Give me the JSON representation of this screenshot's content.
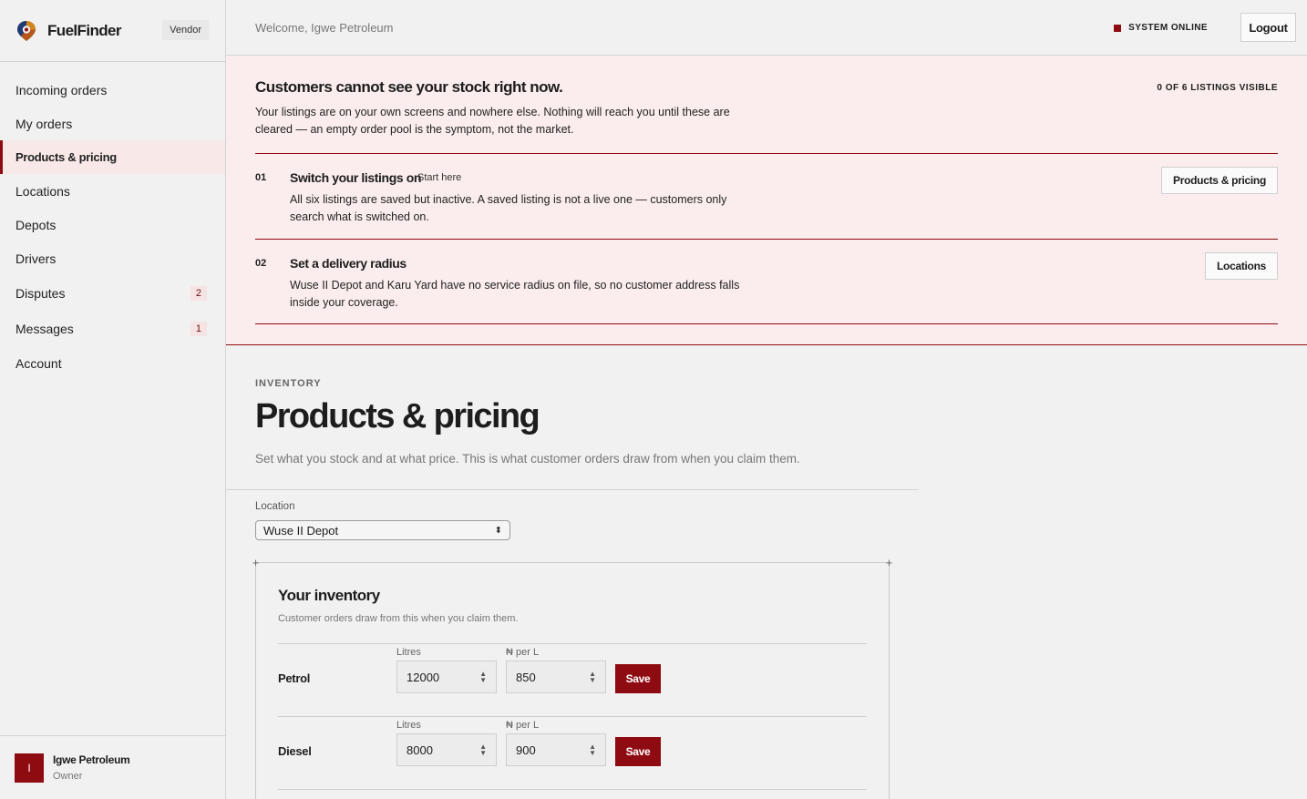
{
  "app": {
    "name": "FuelFinder",
    "role_badge": "Vendor"
  },
  "sidebar": {
    "items": [
      {
        "label": "Incoming orders"
      },
      {
        "label": "My orders"
      },
      {
        "label": "Products & pricing",
        "active": true
      },
      {
        "label": "Locations"
      },
      {
        "label": "Depots"
      },
      {
        "label": "Drivers"
      },
      {
        "label": "Disputes",
        "badge": "2"
      },
      {
        "label": "Messages",
        "badge": "1"
      },
      {
        "label": "Account"
      }
    ],
    "user": {
      "initial": "I",
      "name": "Igwe Petroleum",
      "role": "Owner"
    }
  },
  "topbar": {
    "welcome": "Welcome, Igwe Petroleum",
    "status": "SYSTEM ONLINE",
    "logout": "Logout"
  },
  "alert": {
    "title": "Customers cannot see your stock right now.",
    "count": "0 OF 6 LISTINGS VISIBLE",
    "description": "Your listings are on your own screens and nowhere else. Nothing will reach you until these are cleared — an empty order pool is the symptom, not the market.",
    "steps": [
      {
        "num": "01",
        "title": "Switch your listings on",
        "tag": "Start here",
        "description": "All six listings are saved but inactive. A saved listing is not a live one — customers only search what is switched on.",
        "button": "Products & pricing"
      },
      {
        "num": "02",
        "title": "Set a delivery radius",
        "tag": "",
        "description": "Wuse II Depot and Karu Yard have no service radius on file, so no customer address falls inside your coverage.",
        "button": "Locations"
      }
    ]
  },
  "page": {
    "eyebrow": "INVENTORY",
    "title": "Products & pricing",
    "subtitle": "Set what you stock and at what price. This is what customer orders draw from when you claim them."
  },
  "location": {
    "label": "Location",
    "selected": "Wuse II Depot"
  },
  "inventory": {
    "title": "Your inventory",
    "subtitle": "Customer orders draw from this when you claim them.",
    "litres_label": "Litres",
    "price_label": "₦ per L",
    "save_label": "Save",
    "products": [
      {
        "name": "Petrol",
        "litres": "12000",
        "price": "850"
      },
      {
        "name": "Diesel",
        "litres": "8000",
        "price": "900"
      }
    ]
  },
  "colors": {
    "accent": "#8f0b12",
    "alert_bg": "#fbeded",
    "page_bg": "#f1f1f1"
  }
}
